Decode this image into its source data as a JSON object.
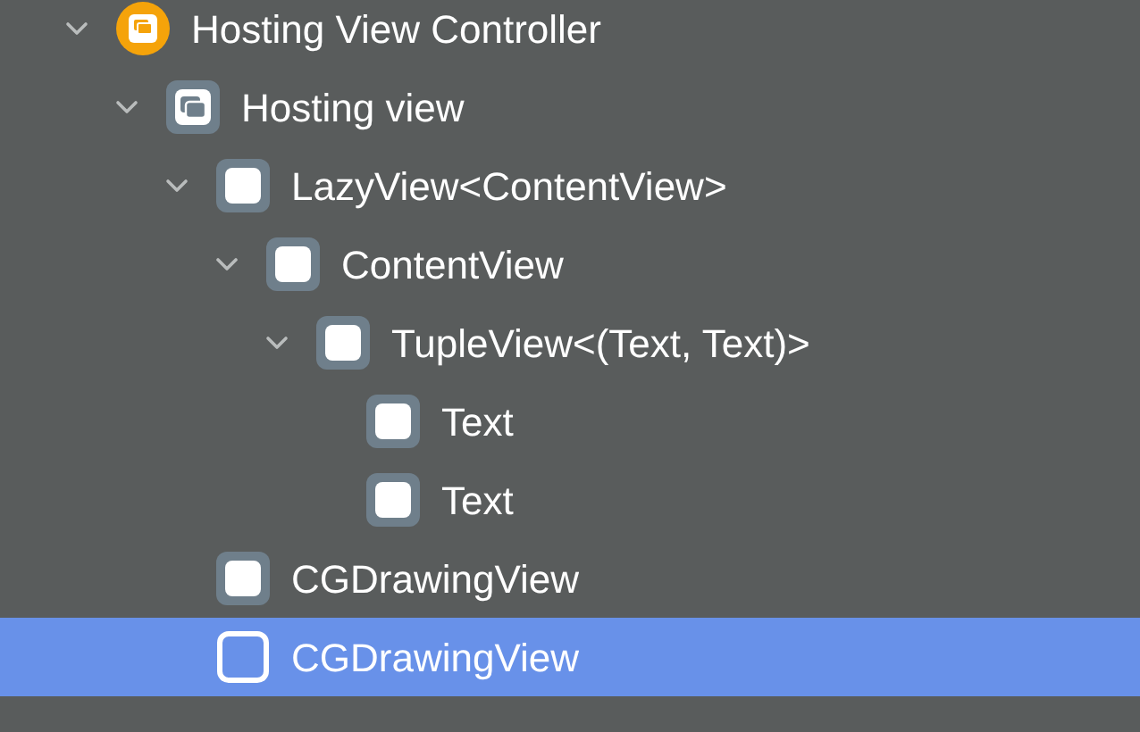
{
  "tree": [
    {
      "kind": "controller",
      "label": "Hosting View Controller",
      "selected": false,
      "expanded": true,
      "children": [
        {
          "kind": "hosting",
          "label": "Hosting view",
          "selected": false,
          "expanded": true,
          "children": [
            {
              "kind": "view",
              "label": "LazyView<ContentView>",
              "selected": false,
              "expanded": true,
              "children": [
                {
                  "kind": "view",
                  "label": "ContentView",
                  "selected": false,
                  "expanded": true,
                  "children": [
                    {
                      "kind": "view",
                      "label": "TupleView<(Text, Text)>",
                      "selected": false,
                      "expanded": true,
                      "children": [
                        {
                          "kind": "view",
                          "label": "Text",
                          "selected": false
                        },
                        {
                          "kind": "view",
                          "label": "Text",
                          "selected": false
                        }
                      ]
                    }
                  ]
                }
              ]
            },
            {
              "kind": "view",
              "label": "CGDrawingView",
              "selected": false
            },
            {
              "kind": "view",
              "label": "CGDrawingView",
              "selected": true
            }
          ]
        }
      ]
    }
  ]
}
